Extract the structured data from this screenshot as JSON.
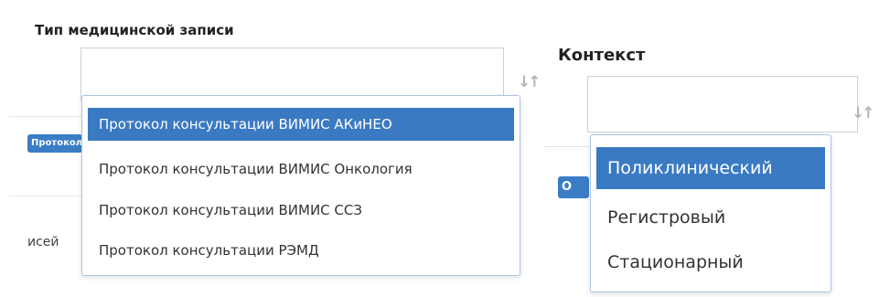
{
  "medical_record_type": {
    "label": "Тип медицинской записи",
    "value": "",
    "badge_text": "Протокол",
    "count_suffix": "исей",
    "options": [
      {
        "label": "Протокол консультации ВИМИС АКиНЕО",
        "selected": true
      },
      {
        "label": "Протокол консультации ВИМИС Онкология",
        "selected": false
      },
      {
        "label": "Протокол консультации ВИМИС ССЗ",
        "selected": false
      },
      {
        "label": "Протокол консультации РЭМД",
        "selected": false
      }
    ]
  },
  "context": {
    "label": "Контекст",
    "value": "",
    "badge_text": "О",
    "options": [
      {
        "label": "Поликлинический",
        "selected": true
      },
      {
        "label": "Регистровый",
        "selected": false
      },
      {
        "label": "Стационарный",
        "selected": false
      }
    ]
  },
  "icons": {
    "sort": "sort-icon"
  },
  "colors": {
    "accent": "#3a7ac3",
    "badge": "#3b7dc5",
    "dropdown_border": "#aac4e4",
    "field_border": "#c9d2dc"
  }
}
